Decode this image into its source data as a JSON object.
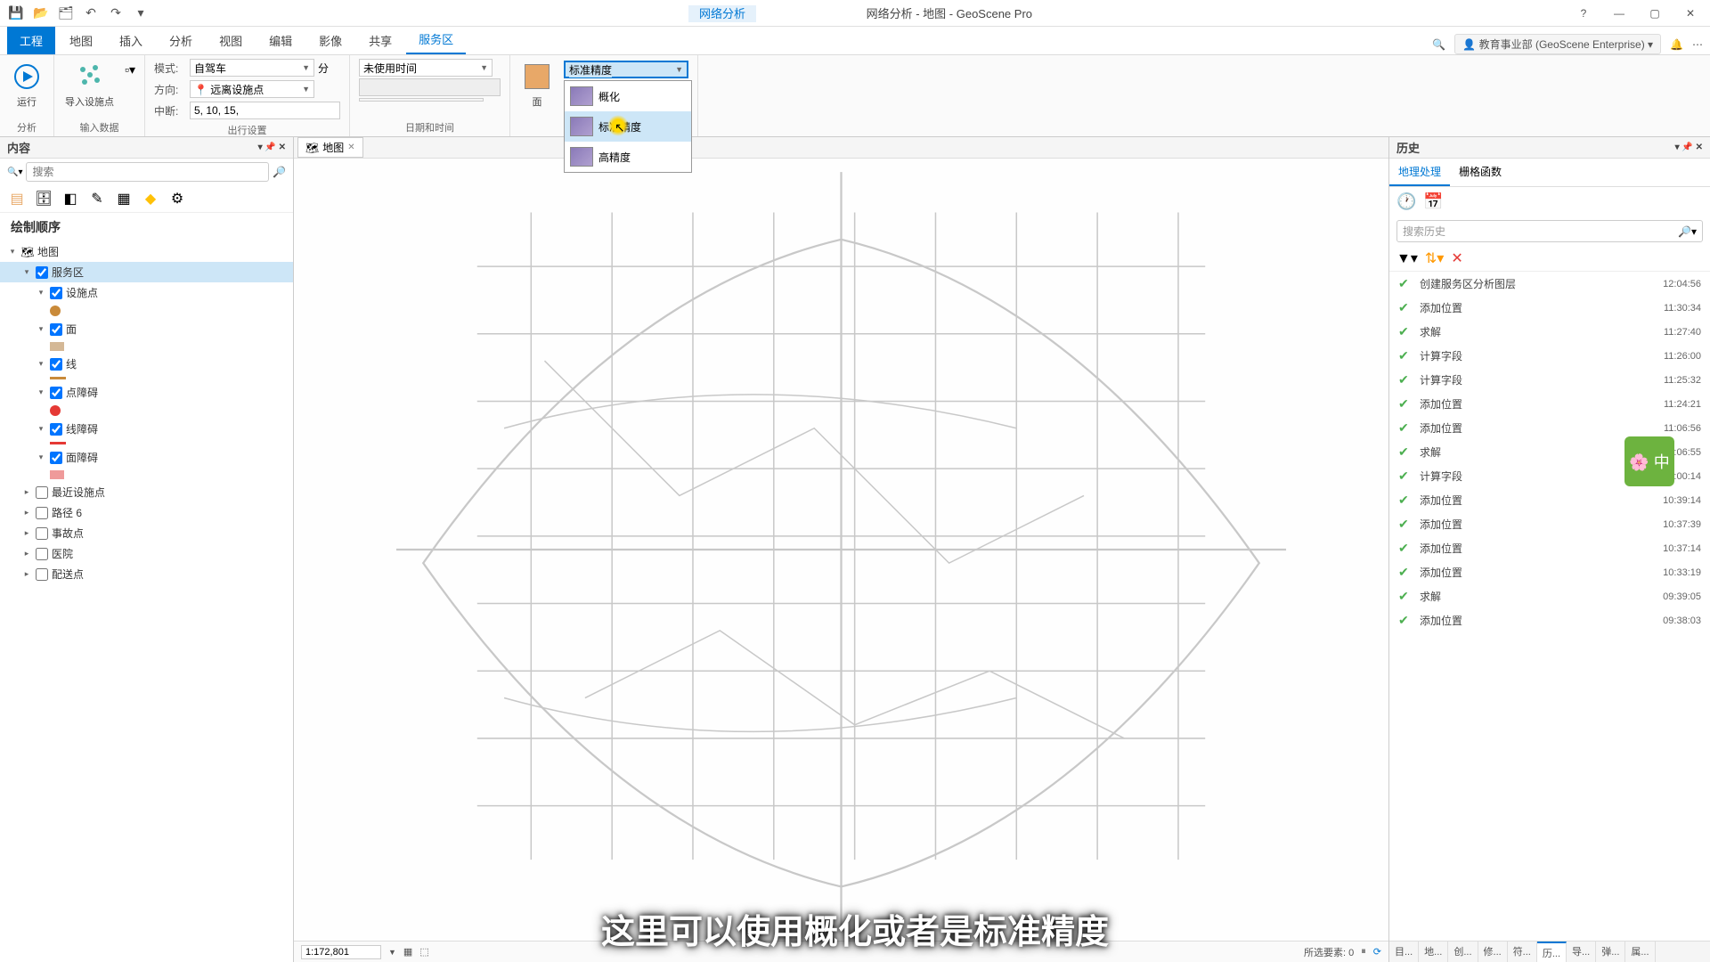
{
  "title": "网络分析 - 地图 - GeoScene Pro",
  "context_tab": "网络分析",
  "ribbon_tabs": {
    "primary": "工程",
    "items": [
      "地图",
      "插入",
      "分析",
      "视图",
      "编辑",
      "影像",
      "共享"
    ],
    "active": "服务区"
  },
  "portal": {
    "label": "教育事业部 (GeoScene Enterprise)"
  },
  "ribbon": {
    "run": "运行",
    "import_facilities": "导入设施点",
    "group_analysis": "分析",
    "group_input": "输入数据",
    "mode_label": "模式:",
    "mode_value": "自驾车",
    "direction_label": "方向:",
    "direction_value": "远离设施点",
    "cutoffs_label": "中断:",
    "cutoffs_value": "5, 10, 15,",
    "unit": "分",
    "group_travel": "出行设置",
    "time_value": "未使用时间",
    "group_datetime": "日期和时间",
    "face": "面",
    "precision_value": "标准精度",
    "precision_options": [
      "概化",
      "标准精度",
      "高精度"
    ]
  },
  "contents": {
    "title": "内容",
    "search_placeholder": "搜索",
    "drawing_order": "绘制顺序",
    "map": "地图",
    "items": [
      {
        "label": "服务区",
        "selected": true
      },
      {
        "label": "设施点",
        "symbol_color": "#c98a3a",
        "symbol_shape": "circle"
      },
      {
        "label": "面",
        "symbol_color": "#d4b896",
        "symbol_shape": "rect"
      },
      {
        "label": "线",
        "symbol_color": "#c98a3a",
        "symbol_shape": "line"
      },
      {
        "label": "点障碍",
        "symbol_color": "#e53935",
        "symbol_shape": "circle"
      },
      {
        "label": "线障碍",
        "symbol_color": "#e53935",
        "symbol_shape": "line"
      },
      {
        "label": "面障碍",
        "symbol_color": "#ef9a9a",
        "symbol_shape": "rect"
      }
    ],
    "unchecked": [
      {
        "label": "最近设施点"
      },
      {
        "label": "路径 6"
      },
      {
        "label": "事故点"
      },
      {
        "label": "医院"
      },
      {
        "label": "配送点"
      }
    ]
  },
  "map_tab": "地图",
  "scale": "1:172,801",
  "selected_count_label": "所选要素: 0",
  "history": {
    "title": "历史",
    "tab1": "地理处理",
    "tab2": "栅格函数",
    "search_placeholder": "搜索历史",
    "items": [
      {
        "name": "创建服务区分析图层",
        "time": "12:04:56"
      },
      {
        "name": "添加位置",
        "time": "11:30:34"
      },
      {
        "name": "求解",
        "time": "11:27:40"
      },
      {
        "name": "计算字段",
        "time": "11:26:00"
      },
      {
        "name": "计算字段",
        "time": "11:25:32"
      },
      {
        "name": "添加位置",
        "time": "11:24:21"
      },
      {
        "name": "添加位置",
        "time": "11:06:56"
      },
      {
        "name": "求解",
        "time": "11:06:55"
      },
      {
        "name": "计算字段",
        "time": "11:00:14"
      },
      {
        "name": "添加位置",
        "time": "10:39:14"
      },
      {
        "name": "添加位置",
        "time": "10:37:39"
      },
      {
        "name": "添加位置",
        "time": "10:37:14"
      },
      {
        "name": "添加位置",
        "time": "10:33:19"
      },
      {
        "name": "求解",
        "time": "09:39:05"
      },
      {
        "name": "添加位置",
        "time": "09:38:03"
      }
    ]
  },
  "bottom_tabs": [
    "目...",
    "地...",
    "创...",
    "修...",
    "符...",
    "历...",
    "导...",
    "弹...",
    "属..."
  ],
  "bottom_active_index": 5,
  "subtitle": "这里可以使用概化或者是标准精度"
}
